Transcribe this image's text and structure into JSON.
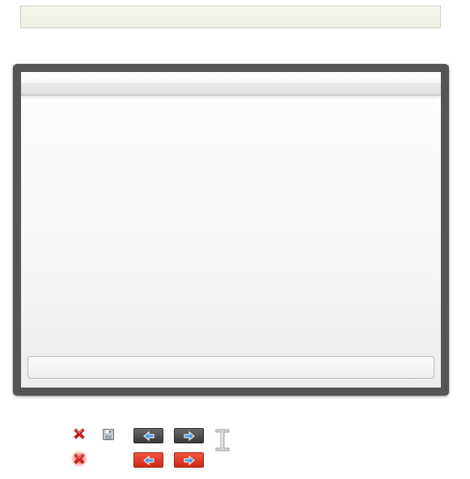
{
  "window": {
    "title": "",
    "status": ""
  },
  "icons": {
    "close": "close-icon",
    "close_hover": "close-icon",
    "save": "save-icon",
    "prev": "arrow-left-icon",
    "next": "arrow-right-icon",
    "resize": "resize-handle-icon"
  },
  "colors": {
    "frame": "#555555",
    "close_red": "#d8201a",
    "arrow_blue": "#4a9ae8",
    "button_dark": "#4a4a4a",
    "button_red": "#e03c28"
  }
}
